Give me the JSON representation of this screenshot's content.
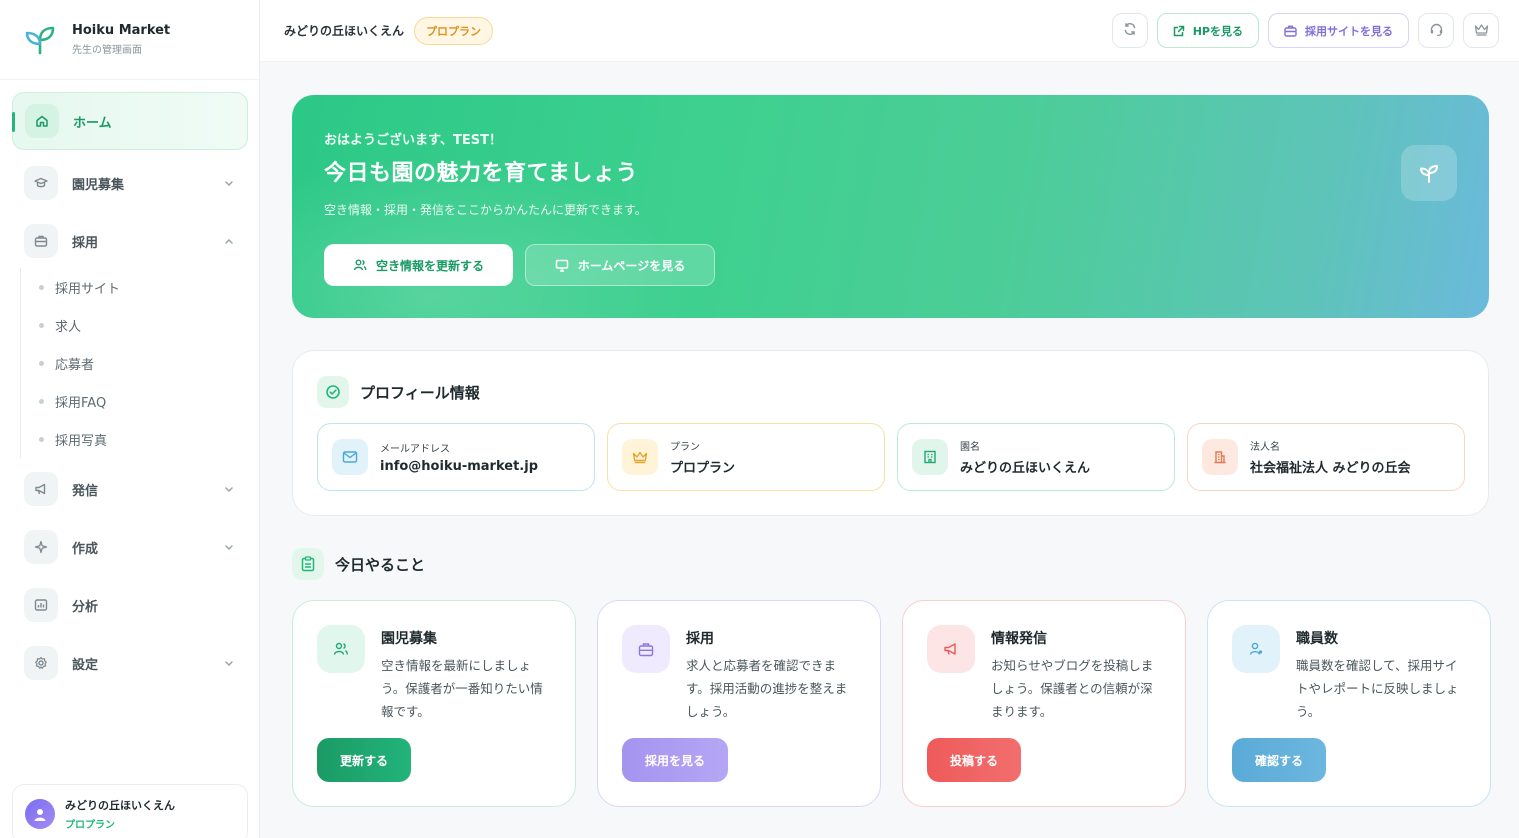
{
  "brand": {
    "title": "Hoiku Market",
    "subtitle": "先生の管理画面"
  },
  "sidebar": {
    "items": [
      {
        "label": "ホーム",
        "icon": "home-icon"
      },
      {
        "label": "園児募集",
        "icon": "graduation-cap-icon"
      },
      {
        "label": "採用",
        "icon": "briefcase-icon"
      },
      {
        "label": "発信",
        "icon": "megaphone-icon"
      },
      {
        "label": "作成",
        "icon": "sparkles-icon"
      },
      {
        "label": "分析",
        "icon": "chart-icon"
      },
      {
        "label": "設定",
        "icon": "gear-icon"
      }
    ],
    "recruit_sub": [
      "採用サイト",
      "求人",
      "応募者",
      "採用FAQ",
      "採用写真"
    ]
  },
  "user": {
    "name": "みどりの丘ほいくえん",
    "plan": "プロプラン"
  },
  "header": {
    "title": "みどりの丘ほいくえん",
    "badge": "プロプラン",
    "hp_button": "HPを見る",
    "recruit_button": "採用サイトを見る"
  },
  "hero": {
    "greeting": "おはようございます、TEST！",
    "title": "今日も園の魅力を育てましょう",
    "subtitle": "空き情報・採用・発信をここからかんたんに更新できます。",
    "btn_update": "空き情報を更新する",
    "btn_home": "ホームページを見る"
  },
  "profile": {
    "title": "プロフィール情報",
    "cards": [
      {
        "label": "メールアドレス",
        "value": "info@hoiku-market.jp"
      },
      {
        "label": "プラン",
        "value": "プロプラン"
      },
      {
        "label": "園名",
        "value": "みどりの丘ほいくえん"
      },
      {
        "label": "法人名",
        "value": "社会福祉法人 みどりの丘会"
      }
    ]
  },
  "today": {
    "title": "今日やること",
    "cards": [
      {
        "title": "園児募集",
        "desc": "空き情報を最新にしましょう。保護者が一番知りたい情報です。",
        "button": "更新する"
      },
      {
        "title": "採用",
        "desc": "求人と応募者を確認できます。採用活動の進捗を整えましょう。",
        "button": "採用を見る"
      },
      {
        "title": "情報発信",
        "desc": "お知らせやブログを投稿しましょう。保護者との信頼が深まります。",
        "button": "投稿する"
      },
      {
        "title": "職員数",
        "desc": "職員数を確認して、採用サイトやレポートに反映しましょう。",
        "button": "確認する"
      }
    ]
  },
  "colors": {
    "accent": "#21b77a",
    "plan_badge": "#e2901c",
    "recruit": "#8070d8",
    "post": "#ef5a5a",
    "staff": "#4aa6d8"
  }
}
